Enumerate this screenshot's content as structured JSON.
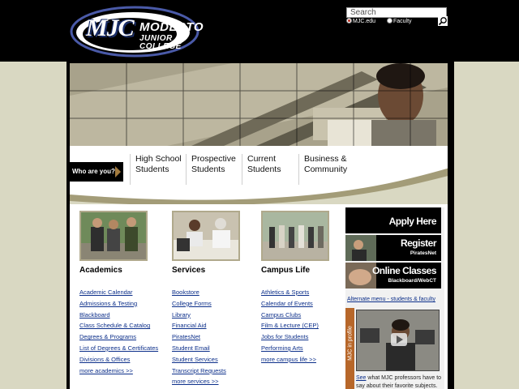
{
  "header": {
    "logo": {
      "mark": "MJC",
      "line1": "MODESTO",
      "line2": "JUNIOR COLLEGE"
    },
    "search": {
      "value": "Search",
      "options": [
        {
          "label": "MJC.edu",
          "selected": true
        },
        {
          "label": "Faculty",
          "selected": false
        }
      ],
      "button_icon": "magnifier-icon"
    }
  },
  "who": {
    "label": "Who are you?",
    "audiences": [
      "High School Students",
      "Prospective Students",
      "Current Students",
      "Business & Community"
    ]
  },
  "columns": [
    {
      "heading": "Academics",
      "links": [
        "Academic Calendar",
        "Admissions & Testing",
        "Blackboard",
        "Class Schedule & Catalog",
        "Degrees & Programs",
        "List of Degrees & Certificates",
        "Divisions & Offices",
        "more academics >>"
      ]
    },
    {
      "heading": "Services",
      "links": [
        "Bookstore",
        "College Forms",
        "Library",
        "Financial Aid",
        "PiratesNet",
        "Student Email",
        "Student Services",
        "Transcript Requests",
        "more services >>"
      ]
    },
    {
      "heading": "Campus Life",
      "links": [
        "Athletics & Sports",
        "Calendar of Events",
        "Campus Clubs",
        "Film & Lecture (CEP)",
        "Jobs for Students",
        "Performing Arts",
        "more campus life >>"
      ]
    }
  ],
  "sidebar": {
    "promos": [
      {
        "title": "Apply Here",
        "sub": ""
      },
      {
        "title": "Register",
        "sub": "PiratesNet"
      },
      {
        "title": "Online Classes",
        "sub": "Blackboard/WebCT"
      }
    ],
    "alt_menu": "Alternate menu - students & faculty",
    "profile_tab": "MJC in profile",
    "video_caption_link": "See",
    "video_caption_text": " what MJC professors have to say about their favorite subjects."
  },
  "colors": {
    "page_bg": "#d9d8c2",
    "header_bg": "#000000",
    "link": "#0c2f8a",
    "accent_orange": "#b7672a",
    "photo_border": "#b0a98c"
  }
}
